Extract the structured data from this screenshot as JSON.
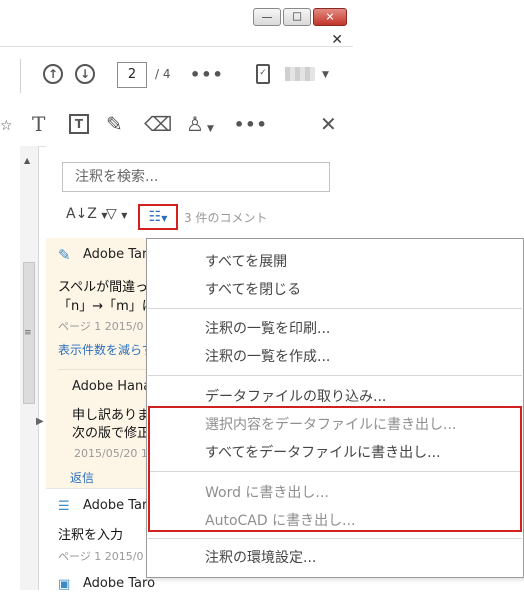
{
  "window": {
    "minimize_glyph": "—",
    "maximize_glyph": "☐",
    "close_glyph": "✕",
    "pane_close_glyph": "✕"
  },
  "toolbar": {
    "current_page": "2",
    "total_pages": "/ 4",
    "more_label": "•••"
  },
  "annot_toolbar": {
    "close_glyph": "✕",
    "more_label": "•••"
  },
  "panel": {
    "search_placeholder": "注釈を検索...",
    "sort_label": "A↓Z",
    "comment_count": "3 件のコメント"
  },
  "comments": [
    {
      "author": "Adobe Taro",
      "text_line1": "スペルが間違っ",
      "text_line2": "「n」→「m」に修正",
      "meta": "ページ 1  2015/0",
      "link": "表示件数を減らす",
      "reply": {
        "author": "Adobe Hana",
        "text_line1": "申し訳ありませ",
        "text_line2": "次の版で修正",
        "meta": "2015/05/20  10",
        "link": "返信"
      }
    },
    {
      "author": "Adobe Taro",
      "text": "注釈を入力",
      "meta": "ページ 1  2015/0"
    },
    {
      "author": "Adobe Taro"
    }
  ],
  "menu": {
    "items": [
      "すべてを展開",
      "すべてを閉じる",
      "注釈の一覧を印刷...",
      "注釈の一覧を作成...",
      "データファイルの取り込み...",
      "選択内容をデータファイルに書き出し...",
      "すべてをデータファイルに書き出し...",
      "Word に書き出し...",
      "AutoCAD に書き出し...",
      "注釈の環境設定..."
    ]
  },
  "colors": {
    "highlight_red": "#d21f1f",
    "accent_blue": "#2a6fbe",
    "comment_bg": "#fdf6e7"
  }
}
